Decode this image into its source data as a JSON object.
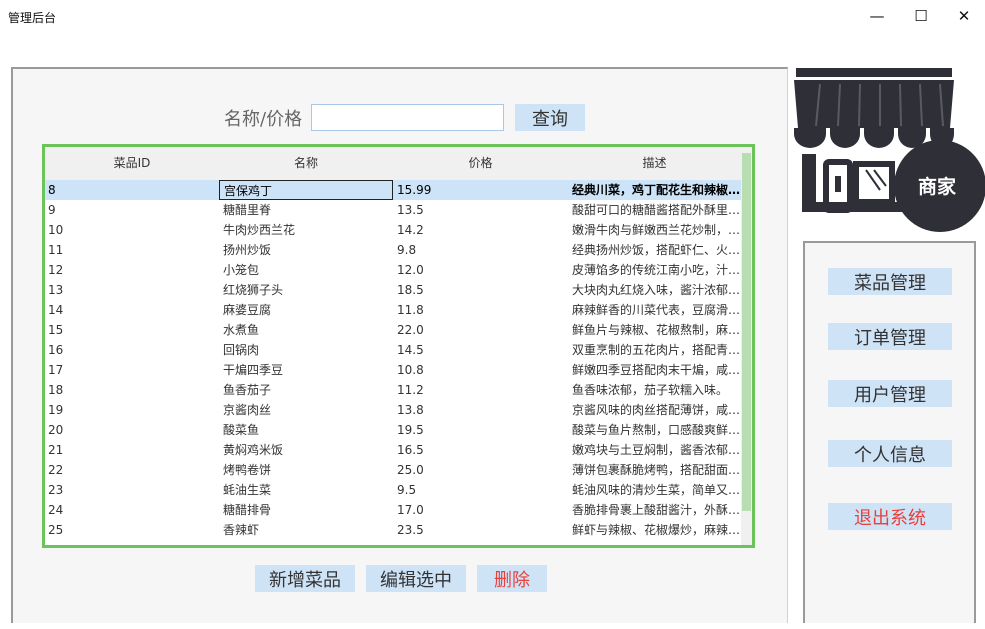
{
  "window": {
    "title": "管理后台",
    "min_label": "—",
    "max_label": "☐",
    "close_label": "✕"
  },
  "search": {
    "label": "名称/价格",
    "value": "",
    "placeholder": "",
    "button": "查询"
  },
  "table": {
    "columns": [
      "菜品ID",
      "名称",
      "价格",
      "描述"
    ],
    "rows": [
      {
        "id": "8",
        "name": "宫保鸡丁",
        "price": "15.99",
        "desc": "经典川菜，鸡丁配花生和辣椒…"
      },
      {
        "id": "9",
        "name": "糖醋里脊",
        "price": "13.5",
        "desc": "酸甜可口的糖醋酱搭配外酥里…"
      },
      {
        "id": "10",
        "name": "牛肉炒西兰花",
        "price": "14.2",
        "desc": "嫩滑牛肉与鲜嫩西兰花炒制，…"
      },
      {
        "id": "11",
        "name": "扬州炒饭",
        "price": "9.8",
        "desc": "经典扬州炒饭，搭配虾仁、火…"
      },
      {
        "id": "12",
        "name": "小笼包",
        "price": "12.0",
        "desc": "皮薄馅多的传统江南小吃，汁…"
      },
      {
        "id": "13",
        "name": "红烧狮子头",
        "price": "18.5",
        "desc": "大块肉丸红烧入味，酱汁浓郁…"
      },
      {
        "id": "14",
        "name": "麻婆豆腐",
        "price": "11.8",
        "desc": "麻辣鲜香的川菜代表，豆腐滑…"
      },
      {
        "id": "15",
        "name": "水煮鱼",
        "price": "22.0",
        "desc": "鲜鱼片与辣椒、花椒熬制，麻…"
      },
      {
        "id": "16",
        "name": "回锅肉",
        "price": "14.5",
        "desc": "双重烹制的五花肉片，搭配青…"
      },
      {
        "id": "17",
        "name": "干煸四季豆",
        "price": "10.8",
        "desc": "鲜嫩四季豆搭配肉末干煸，咸…"
      },
      {
        "id": "18",
        "name": "鱼香茄子",
        "price": "11.2",
        "desc": "鱼香味浓郁，茄子软糯入味。"
      },
      {
        "id": "19",
        "name": "京酱肉丝",
        "price": "13.8",
        "desc": "京酱风味的肉丝搭配薄饼，咸…"
      },
      {
        "id": "20",
        "name": "酸菜鱼",
        "price": "19.5",
        "desc": "酸菜与鱼片熬制，口感酸爽鲜…"
      },
      {
        "id": "21",
        "name": "黄焖鸡米饭",
        "price": "16.5",
        "desc": "嫩鸡块与土豆焖制，酱香浓郁…"
      },
      {
        "id": "22",
        "name": "烤鸭卷饼",
        "price": "25.0",
        "desc": "薄饼包裹酥脆烤鸭，搭配甜面…"
      },
      {
        "id": "23",
        "name": "蚝油生菜",
        "price": "9.5",
        "desc": "蚝油风味的清炒生菜，简单又…"
      },
      {
        "id": "24",
        "name": "糖醋排骨",
        "price": "17.0",
        "desc": "香脆排骨裹上酸甜酱汁，外酥…"
      },
      {
        "id": "25",
        "name": "香辣虾",
        "price": "23.5",
        "desc": "鲜虾与辣椒、花椒爆炒，麻辣…"
      }
    ],
    "selected_row": 0
  },
  "actions": {
    "add": "新增菜品",
    "edit": "编辑选中",
    "delete": "删除"
  },
  "logo": {
    "text": "商家",
    "icon": "storefront-icon"
  },
  "nav": {
    "dishes": "菜品管理",
    "orders": "订单管理",
    "users": "用户管理",
    "profile": "个人信息",
    "logout": "退出系统"
  },
  "colors": {
    "accent_button": "#cfe3f7",
    "table_border": "#6cc35a",
    "danger_text": "#e8403a",
    "selected_row": "#cde3f8"
  }
}
